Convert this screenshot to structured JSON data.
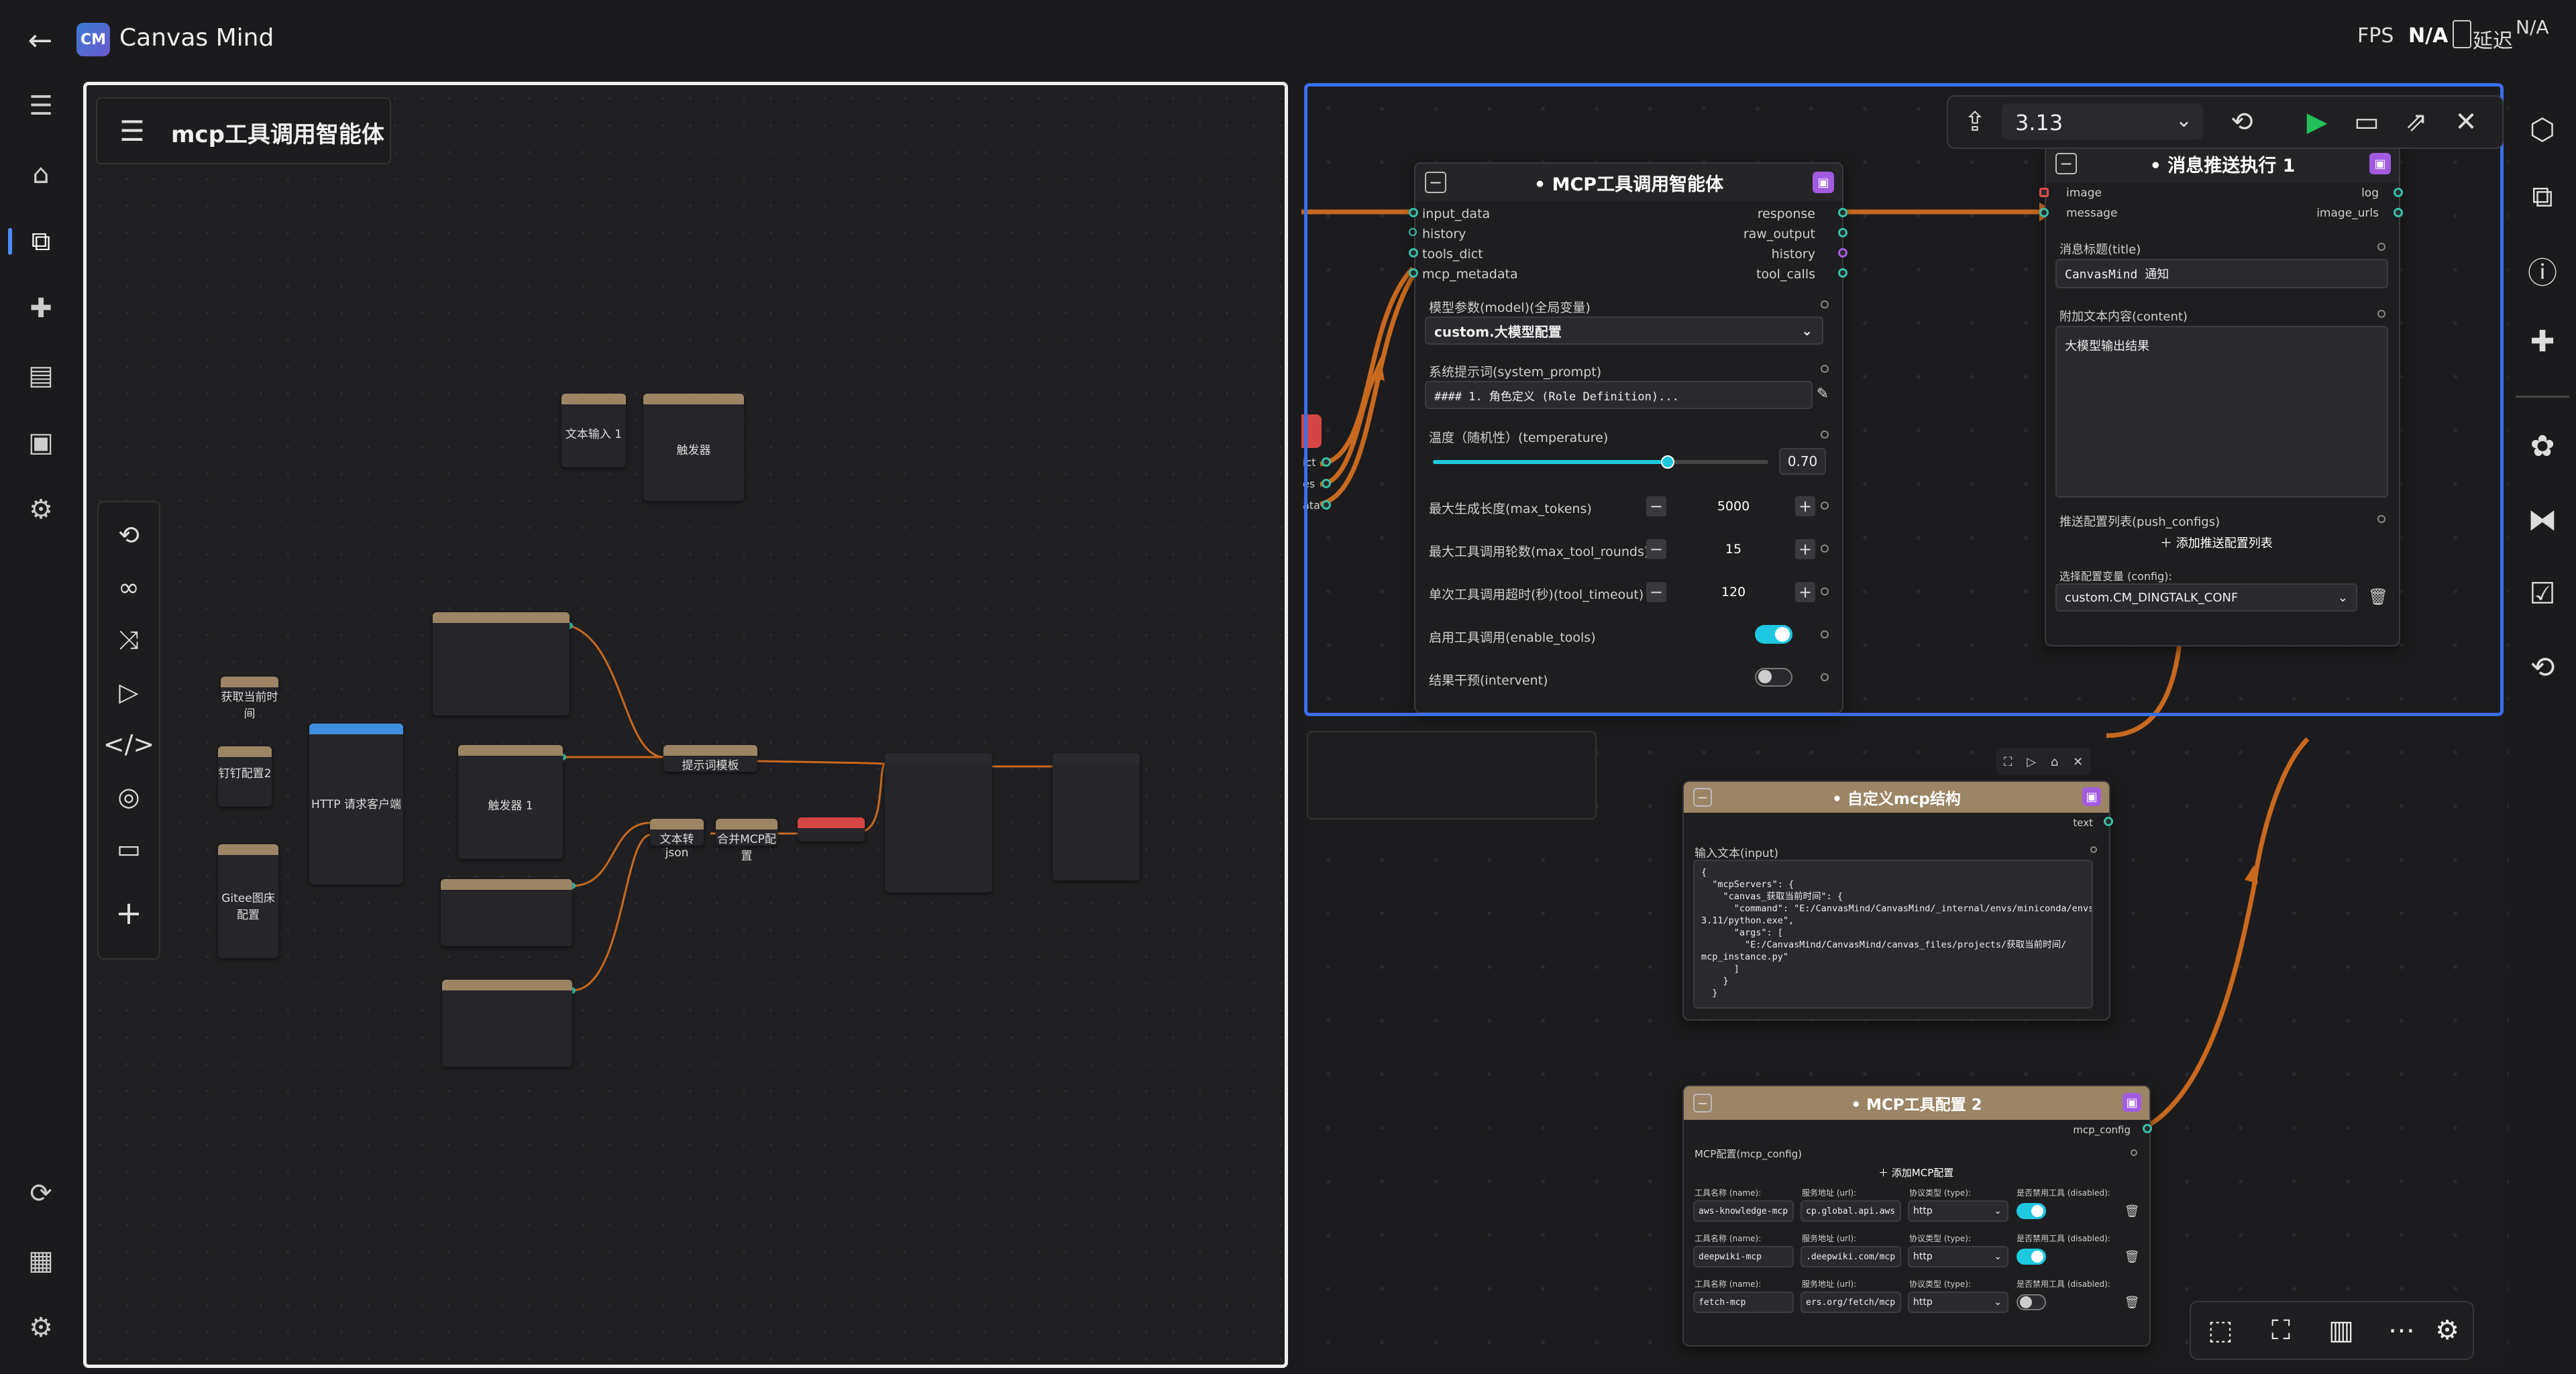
{
  "titlebar": {
    "app_title": "Canvas Mind",
    "fps_label": "FPS",
    "fps_value": "N/A",
    "latency_label": "延迟",
    "latency_value": "N/A"
  },
  "left_panel": {
    "title": "mcp工具调用智能体",
    "mini_nodes": {
      "text_input": "文本输入 1",
      "trigger_top": "触发器",
      "get_time": "获取当前时间",
      "dingtalk": "钉钉配置2",
      "http_client": "HTTP 请求客户端",
      "gitee": "Gitee图床配置",
      "trigger_1": "触发器 1",
      "prompt_template": "提示词模板",
      "text_to_json": "文本转json",
      "merge_mcp": "合并MCP配置"
    }
  },
  "toolbar": {
    "version": "3.13"
  },
  "mcp_agent_node": {
    "title": "MCP工具调用智能体",
    "inputs": [
      "input_data",
      "history",
      "tools_dict",
      "mcp_metadata"
    ],
    "outputs": [
      "response",
      "raw_output",
      "history",
      "tool_calls"
    ],
    "model_label": "模型参数(model)(全局变量)",
    "model_value": "custom.大模型配置",
    "system_prompt_label": "系统提示词(system_prompt)",
    "system_prompt_value": "#### 1. 角色定义 (Role Definition)...",
    "temperature_label": "温度（随机性）(temperature)",
    "temperature_value": "0.70",
    "temperature_fraction": 0.7,
    "max_tokens_label": "最大生成长度(max_tokens)",
    "max_tokens_value": "5000",
    "max_tool_rounds_label": "最大工具调用轮数(max_tool_rounds)",
    "max_tool_rounds_value": "15",
    "tool_timeout_label": "单次工具调用超时(秒)(tool_timeout)",
    "tool_timeout_value": "120",
    "enable_tools_label": "启用工具调用(enable_tools)",
    "enable_tools_on": true,
    "intervent_label": "结果干预(intervent)",
    "intervent_on": false
  },
  "push_node": {
    "title": "消息推送执行 1",
    "inputs": [
      "image",
      "message"
    ],
    "outputs": [
      "log",
      "image_urls"
    ],
    "title_label": "消息标题(title)",
    "title_value": "CanvasMind 通知",
    "content_label": "附加文本内容(content)",
    "content_value": "大模型输出结果",
    "push_configs_label": "推送配置列表(push_configs)",
    "add_push_label": "添加推送配置列表",
    "config_label": "选择配置变量 (config):",
    "config_value": "custom.CM_DINGTALK_CONF"
  },
  "partial_node_ports": [
    "ict",
    "es",
    "ata"
  ],
  "custom_mcp_node": {
    "title": "自定义mcp结构",
    "output": "text",
    "input_label": "输入文本(input)",
    "code_lines": [
      "{",
      "  \"mcpServers\": {",
      "    \"canvas_获取当前时间\": {",
      "      \"command\": \"E:/CanvasMind/CanvasMind/_internal/envs/miniconda/envs/",
      "3.11/python.exe\",",
      "      \"args\": [",
      "        \"E:/CanvasMind/CanvasMind/canvas_files/projects/获取当前时间/",
      "mcp_instance.py\"",
      "      ]",
      "    }",
      "  }"
    ]
  },
  "mcp_tool_config_node": {
    "title": "MCP工具配置 2",
    "output": "mcp_config",
    "config_label": "MCP配置(mcp_config)",
    "add_label": "添加MCP配置",
    "col_name": "工具名称 (name):",
    "col_url": "服务地址 (url):",
    "col_type": "协议类型 (type):",
    "col_disabled": "是否禁用工具 (disabled):",
    "rows": [
      {
        "name": "aws-knowledge-mcp",
        "url": "cp.global.api.aws",
        "type": "http",
        "toggle_on": true
      },
      {
        "name": "deepwiki-mcp",
        "url": ".deepwiki.com/mcp",
        "type": "http",
        "toggle_on": true
      },
      {
        "name": "fetch-mcp",
        "url": "ers.org/fetch/mcp",
        "type": "http",
        "toggle_on": false
      }
    ]
  },
  "colors": {
    "accent": "#3a6ff0",
    "wire": "#c8691f",
    "port": "#36c0a8",
    "node_header_tan": "#9c8565",
    "toggle_on": "#1ec8e0",
    "run_green": "#22c05a"
  }
}
